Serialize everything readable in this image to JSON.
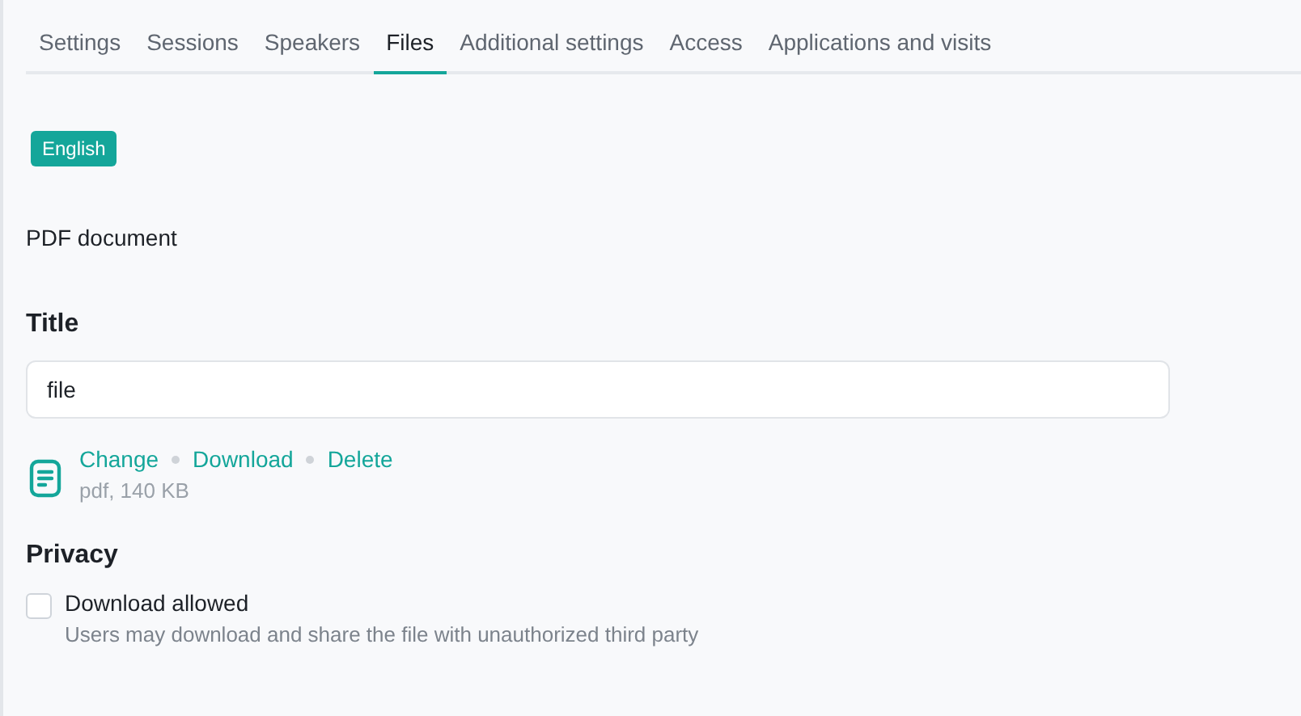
{
  "tabs": [
    {
      "label": "Settings",
      "selected": false
    },
    {
      "label": "Sessions",
      "selected": false
    },
    {
      "label": "Speakers",
      "selected": false
    },
    {
      "label": "Files",
      "selected": true
    },
    {
      "label": "Additional settings",
      "selected": false
    },
    {
      "label": "Access",
      "selected": false
    },
    {
      "label": "Applications and visits",
      "selected": false
    }
  ],
  "language_badge": "English",
  "file_type_label": "PDF document",
  "title_field": {
    "label": "Title",
    "value": "file"
  },
  "file": {
    "actions": [
      "Change",
      "Download",
      "Delete"
    ],
    "info": "pdf, 140 KB"
  },
  "privacy": {
    "heading": "Privacy",
    "option": {
      "label": "Download allowed",
      "description": "Users may download and share the file with unauthorized third party",
      "checked": false
    }
  }
}
